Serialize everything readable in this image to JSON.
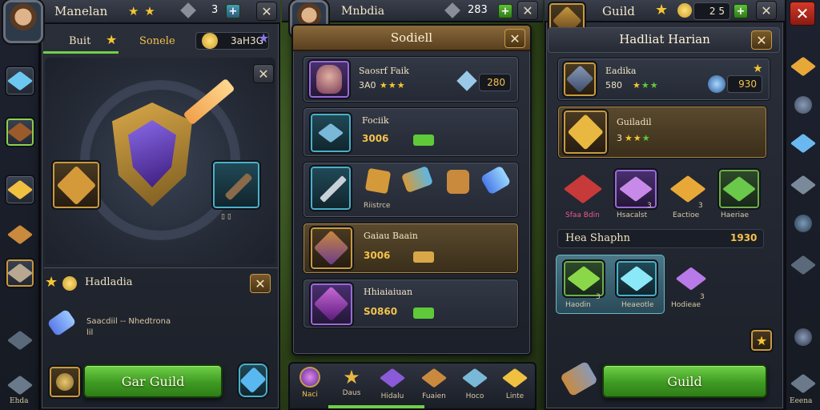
{
  "colors": {
    "gold": "#f4c24a",
    "green_button": "#4aaa2a",
    "accent_red": "#d43a2a",
    "star": "#f5c632"
  },
  "left_panel": {
    "player_name": "Manelan",
    "resource_value": "3",
    "tab_build": "Buit",
    "tab_social": "Sonele",
    "currency_value": "3aH3G",
    "section_title": "Hadladia",
    "item_text": "Saacdiil -- Nhedtrona",
    "item_subtext": "lil",
    "bottom_button": "Gar Guild"
  },
  "middle_panel": {
    "player_name": "Mnbdia",
    "counter_value": "283",
    "title": "Sodiell",
    "rows": [
      {
        "name": "Saosrf Faik",
        "sub": "3A0",
        "stars": "★★★",
        "value": "280"
      },
      {
        "name": "Fociik",
        "value": "3006"
      },
      {
        "name": "Riistrce"
      },
      {
        "name": "Gaiau Baain",
        "value": "3006"
      },
      {
        "name": "Hhiaiaiuan",
        "value": "S0860"
      }
    ],
    "nav": [
      "Naci",
      "Daus",
      "Hidalu",
      "Fuaien",
      "Hoco",
      "Linte"
    ]
  },
  "right_panel": {
    "title_short": "Guild",
    "gold_value": "2 5",
    "title": "Hadliat Harian",
    "rows": [
      {
        "name": "Eadika",
        "sub": "580",
        "value": "930"
      },
      {
        "name": "Guiladil",
        "sub": "3"
      }
    ],
    "items": [
      {
        "label": "Sfaa Bdin"
      },
      {
        "label": "Hsacalst",
        "badge": "3"
      },
      {
        "label": "Eactioe",
        "badge": "3"
      },
      {
        "label": "Haeriae"
      }
    ],
    "section_title": "Hea Shaphn",
    "section_value": "1930",
    "shop_items": [
      {
        "label": "Haodin",
        "badge": "3"
      },
      {
        "label": "Heaeotle"
      },
      {
        "label": "Hodieae",
        "badge": "3"
      }
    ],
    "bottom_button": "Guild"
  },
  "left_rail": {
    "bottom_label": "Ehda"
  },
  "right_rail": {
    "bottom_label": "Eeena"
  }
}
